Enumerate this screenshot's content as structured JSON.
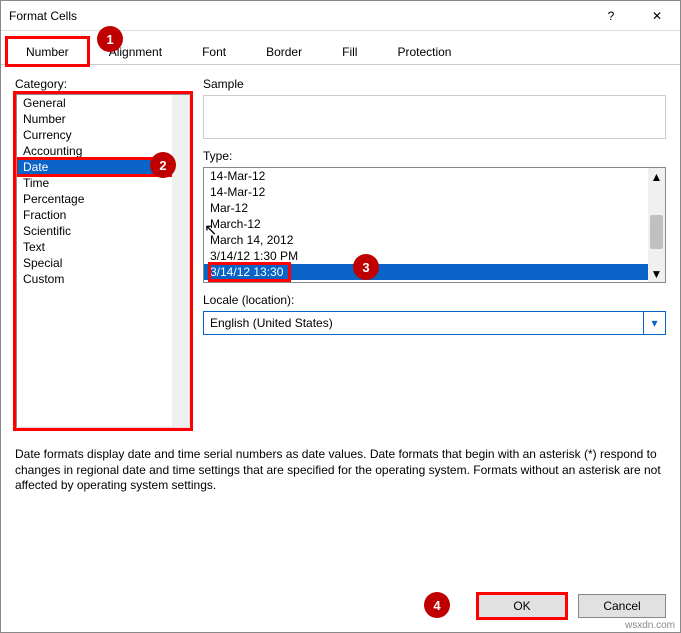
{
  "title": "Format Cells",
  "titlebar": {
    "help": "?",
    "close": "✕"
  },
  "tabs": {
    "number": "Number",
    "alignment": "Alignment",
    "font": "Font",
    "border": "Border",
    "fill": "Fill",
    "protection": "Protection"
  },
  "labels": {
    "category": "Category:",
    "sample": "Sample",
    "type": "Type:",
    "locale": "Locale (location):"
  },
  "categories": [
    "General",
    "Number",
    "Currency",
    "Accounting",
    "Date",
    "Time",
    "Percentage",
    "Fraction",
    "Scientific",
    "Text",
    "Special",
    "Custom"
  ],
  "category_selected_index": 4,
  "types": [
    "14-Mar-12",
    "14-Mar-12",
    "Mar-12",
    "March-12",
    "March 14, 2012",
    "3/14/12 1:30 PM",
    "3/14/12 13:30"
  ],
  "type_selected_index": 6,
  "locale_value": "English (United States)",
  "description": "Date formats display date and time serial numbers as date values.  Date formats that begin with an asterisk (*) respond to changes in regional date and time settings that are specified for the operating system. Formats without an asterisk are not affected by operating system settings.",
  "buttons": {
    "ok": "OK",
    "cancel": "Cancel"
  },
  "annotations": {
    "b1": "1",
    "b2": "2",
    "b3": "3",
    "b4": "4"
  },
  "watermark": "wsxdn.com"
}
